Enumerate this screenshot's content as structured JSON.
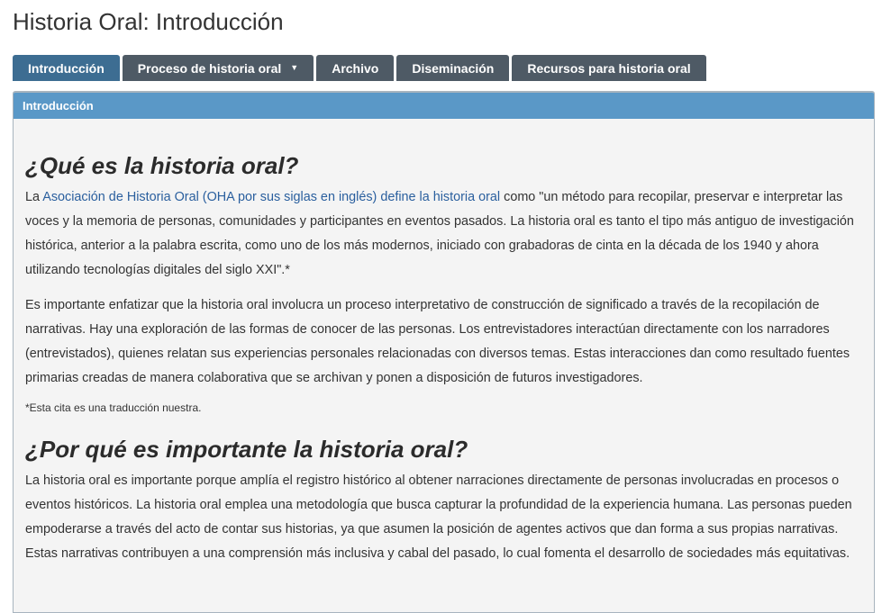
{
  "page": {
    "title": "Historia Oral: Introducción"
  },
  "tabs": [
    {
      "label": "Introducción",
      "active": true
    },
    {
      "label": "Proceso de historia oral",
      "has_dropdown": true
    },
    {
      "label": "Archivo"
    },
    {
      "label": "Diseminación"
    },
    {
      "label": "Recursos para historia oral"
    }
  ],
  "panel": {
    "heading": "Introducción",
    "section1": {
      "heading": "¿Qué es la historia oral?",
      "p1_prefix": "La ",
      "p1_link": "Asociación de Historia Oral (OHA por sus siglas en inglés) define la historia oral",
      "p1_suffix": " como \"un método para recopilar, preservar e interpretar las voces y la memoria de personas, comunidades y participantes en eventos pasados. La historia oral es tanto el tipo más antiguo de investigación histórica, anterior a la palabra escrita, como uno de los más modernos, iniciado con grabadoras de cinta en la década de los 1940 y ahora utilizando tecnologías digitales del siglo XXI\".*",
      "p2": "Es importante enfatizar que la historia oral involucra un proceso interpretativo de construcción de significado a través de la recopilación de narrativas. Hay una exploración de las formas de conocer de las personas. Los entrevistadores interactúan directamente con los narradores (entrevistados), quienes relatan sus experiencias personales relacionadas con diversos temas. Estas interacciones dan como resultado fuentes primarias creadas de manera colaborativa que se archivan y ponen a disposición de futuros investigadores.",
      "footnote": "*Esta cita es una traducción nuestra."
    },
    "section2": {
      "heading": "¿Por qué es importante la historia oral?",
      "p1": "La historia oral es importante porque amplía el registro histórico al obtener narraciones directamente de personas involucradas en procesos o eventos históricos. La historia oral emplea una metodología que busca capturar la profundidad de la experiencia humana. Las personas pueden empoderarse a través del acto de contar sus historias, ya que asumen la posición de agentes activos que dan forma a sus propias narrativas. Estas narrativas contribuyen a una comprensión más inclusiva y cabal del pasado, lo cual fomenta el desarrollo de sociedades más equitativas."
    }
  },
  "colors": {
    "tab_inactive": "#4e5a65",
    "tab_active": "#3d6d92",
    "panel_heading": "#5a98c7",
    "link": "#2a5f9e"
  }
}
